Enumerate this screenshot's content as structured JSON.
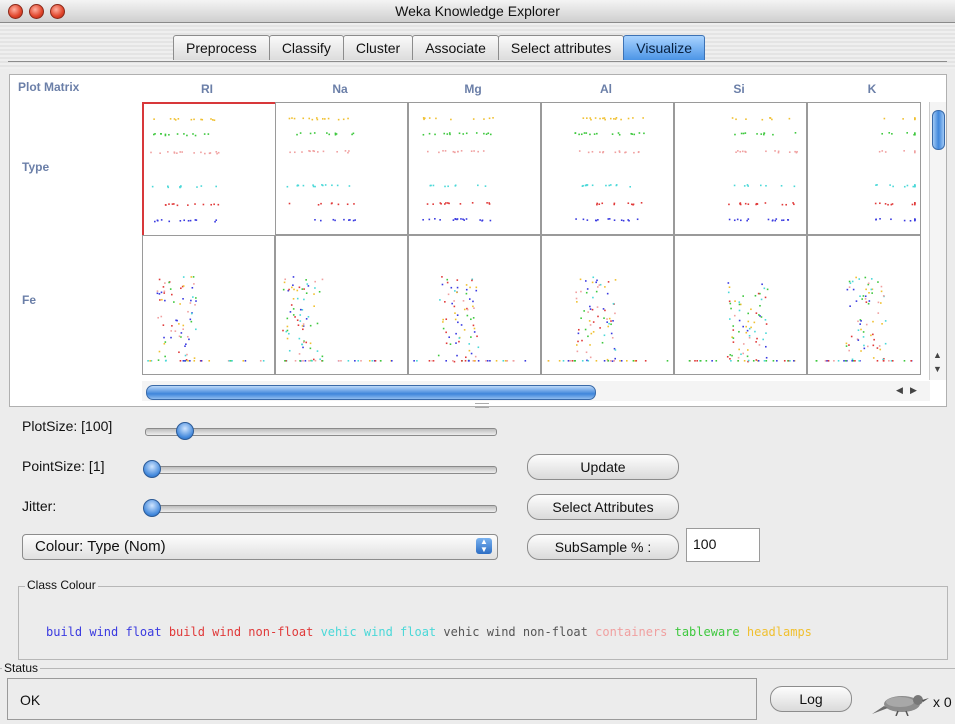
{
  "window": {
    "title": "Weka Knowledge Explorer"
  },
  "tabs": [
    {
      "label": "Preprocess",
      "active": false
    },
    {
      "label": "Classify",
      "active": false
    },
    {
      "label": "Cluster",
      "active": false
    },
    {
      "label": "Associate",
      "active": false
    },
    {
      "label": "Select attributes",
      "active": false
    },
    {
      "label": "Visualize",
      "active": true
    }
  ],
  "matrix": {
    "header": "Plot Matrix",
    "columns": [
      "RI",
      "Na",
      "Mg",
      "Al",
      "Si",
      "K"
    ],
    "rows": [
      "Type",
      "Fe"
    ]
  },
  "controls": {
    "plotsize_label": "PlotSize: [100]",
    "pointsize_label": "PointSize: [1]",
    "jitter_label": "Jitter:",
    "update_button": "Update",
    "select_attributes_button": "Select Attributes",
    "colour_select": "Colour: Type  (Nom)",
    "subsample_button": "SubSample % :",
    "subsample_value": "100"
  },
  "class_colour": {
    "legend": "Class Colour",
    "classes": [
      {
        "label": "build wind float",
        "color": "#3a3ae0"
      },
      {
        "label": "build wind non-float",
        "color": "#e03a3a"
      },
      {
        "label": "vehic wind float",
        "color": "#4ad8d8"
      },
      {
        "label": "vehic wind non-float",
        "color": "#555555"
      },
      {
        "label": "containers",
        "color": "#f0a0a0"
      },
      {
        "label": "tableware",
        "color": "#3ec83e"
      },
      {
        "label": "headlamps",
        "color": "#f0c030"
      }
    ]
  },
  "status": {
    "legend": "Status",
    "text": "OK",
    "log_button": "Log",
    "count_text": "x 0"
  },
  "icons": {
    "weka_bird": "weka-bird-icon"
  }
}
